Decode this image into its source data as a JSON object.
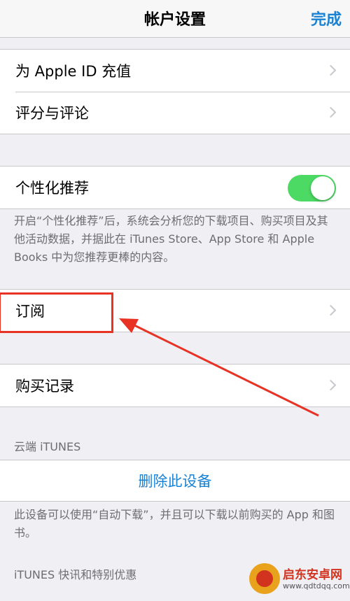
{
  "navbar": {
    "title": "帐户设置",
    "done_label": "完成"
  },
  "group_account": {
    "items": [
      {
        "label": "为 Apple ID 充值"
      },
      {
        "label": "评分与评论"
      }
    ]
  },
  "personalized": {
    "label": "个性化推荐",
    "toggle_on": true,
    "footer": "开启“个性化推荐”后，系统会分析您的下载项目、购买项目及其他活动数据，并据此在 iTunes Store、App Store 和 Apple Books 中为您推荐更棒的内容。"
  },
  "subscriptions": {
    "label": "订阅"
  },
  "purchase_history": {
    "label": "购买记录"
  },
  "cloud": {
    "header": "云端 iTUNES",
    "remove_label": "删除此设备",
    "footer": "此设备可以使用“自动下载”，并且可以下载以前购买的 App 和图书。"
  },
  "newsletter": {
    "header": "iTUNES 快讯和特别优惠"
  },
  "annotation": {
    "color": "#e83324"
  },
  "watermark": {
    "title": "启东安卓网",
    "url": "www.qdtdqq.com"
  },
  "colors": {
    "accent": "#1a82d4",
    "toggle_on": "#4cd964",
    "background": "#efeff4"
  }
}
